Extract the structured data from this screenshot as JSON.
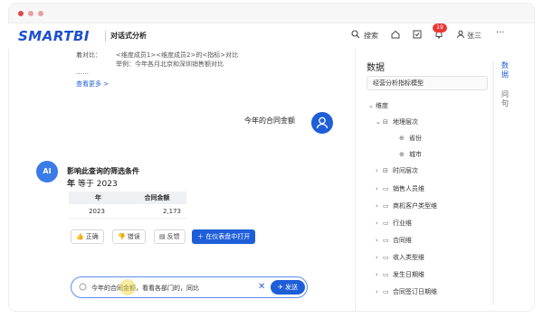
{
  "header": {
    "logo": "SMARTBI",
    "app_name": "对话式分析",
    "search_label": "搜索",
    "notification_count": "19",
    "user_name": "张三"
  },
  "history": {
    "compare_label": "着对比：",
    "template": "<维度成员1><维度成员2>的<指标>对比",
    "example": "举例：今年各月北京和深圳销售额对比",
    "ellipsis": "……",
    "view_more": "查看更多 >"
  },
  "question": {
    "text": "今年的合同金额"
  },
  "answer": {
    "avatar_label": "AI",
    "filter_title": "影响此查询的筛选条件",
    "filter_field": "年",
    "filter_op": "等于",
    "filter_value": "2023",
    "table": {
      "headers": [
        "年",
        "合同金额"
      ],
      "rows": [
        [
          "2023",
          "2,173"
        ]
      ]
    },
    "actions": {
      "correct": "正确",
      "wrong": "错误",
      "feedback": "反馈",
      "open_dashboard": "在仪表盘中打开"
    }
  },
  "input": {
    "value": "今年的合同金额，看看各部门的，同比",
    "send_label": "发送"
  },
  "panel": {
    "title": "数据",
    "model": "经营分析指标模型",
    "dimension_header": "维度",
    "tree": [
      {
        "label": "地理层次",
        "level": 1,
        "expanded": true,
        "icon": "hierarchy"
      },
      {
        "label": "省份",
        "level": 2,
        "icon": "globe"
      },
      {
        "label": "城市",
        "level": 2,
        "icon": "globe"
      },
      {
        "label": "时间层次",
        "level": 1,
        "expanded": false,
        "icon": "hierarchy"
      },
      {
        "label": "销售人员维",
        "level": 1,
        "expanded": false,
        "icon": "folder"
      },
      {
        "label": "商机客户类型维",
        "level": 1,
        "expanded": false,
        "icon": "folder"
      },
      {
        "label": "行业维",
        "level": 1,
        "expanded": false,
        "icon": "folder"
      },
      {
        "label": "合同维",
        "level": 1,
        "expanded": false,
        "icon": "folder"
      },
      {
        "label": "收入类型维",
        "level": 1,
        "expanded": false,
        "icon": "folder"
      },
      {
        "label": "发生日期维",
        "level": 1,
        "expanded": false,
        "icon": "folder"
      },
      {
        "label": "合同签订日期维",
        "level": 1,
        "expanded": false,
        "icon": "folder"
      }
    ]
  },
  "side_tabs": [
    {
      "label": "数据",
      "active": true
    },
    {
      "label": "问句",
      "active": false
    }
  ],
  "colors": {
    "brand": "#1e5ed8",
    "badge": "#e53935"
  }
}
